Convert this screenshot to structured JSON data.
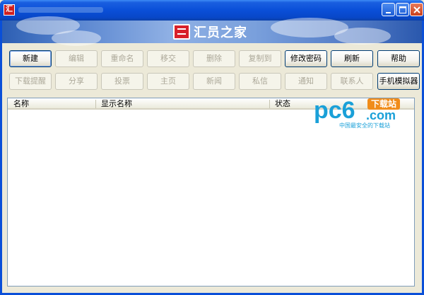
{
  "window": {
    "title": "",
    "accent": "#0a4fd8"
  },
  "app_icon": {
    "glyph": "汇"
  },
  "banner": {
    "brand": "汇员之家"
  },
  "toolbar_row1": [
    {
      "label": "新建",
      "enabled": true
    },
    {
      "label": "编辑",
      "enabled": false
    },
    {
      "label": "重命名",
      "enabled": false
    },
    {
      "label": "移交",
      "enabled": false
    },
    {
      "label": "删除",
      "enabled": false
    },
    {
      "label": "复制到",
      "enabled": false
    },
    {
      "label": "修改密码",
      "enabled": true
    },
    {
      "label": "刷新",
      "enabled": true
    },
    {
      "label": "帮助",
      "enabled": true
    }
  ],
  "toolbar_row2": [
    {
      "label": "下载提醒",
      "enabled": false
    },
    {
      "label": "分享",
      "enabled": false
    },
    {
      "label": "投票",
      "enabled": false
    },
    {
      "label": "主页",
      "enabled": false
    },
    {
      "label": "新闻",
      "enabled": false
    },
    {
      "label": "私信",
      "enabled": false
    },
    {
      "label": "通知",
      "enabled": false
    },
    {
      "label": "联系人",
      "enabled": false
    },
    {
      "label": "手机模拟器",
      "enabled": true
    }
  ],
  "list": {
    "columns": [
      "名称",
      "显示名称",
      "状态"
    ],
    "rows": []
  },
  "watermark": {
    "brand": "pc6",
    "badge": "下载站",
    "domain": ".com",
    "tagline": "中国最安全的下载站"
  }
}
